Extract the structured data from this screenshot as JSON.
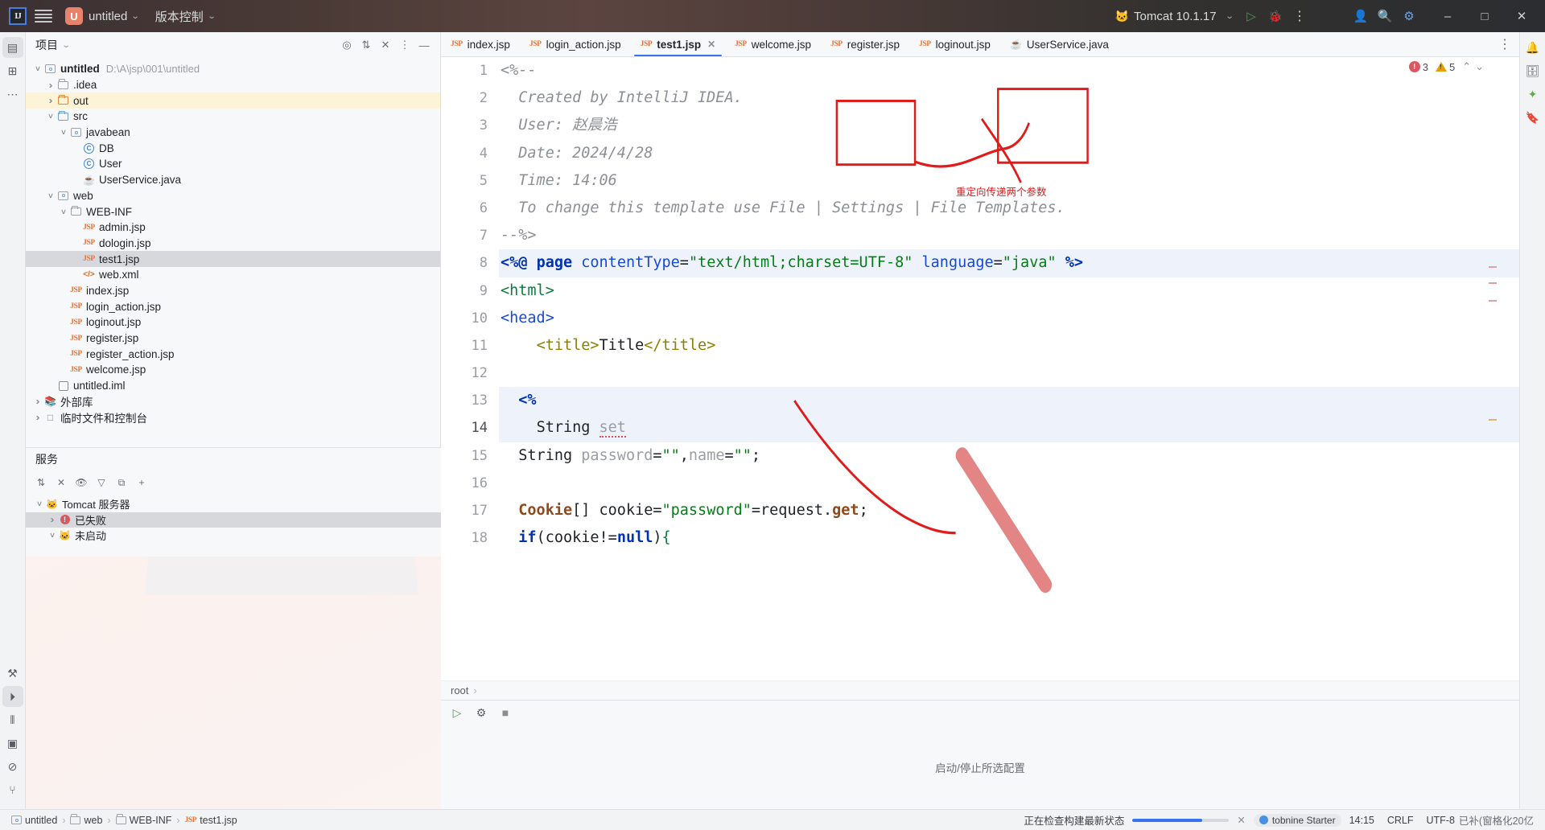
{
  "titlebar": {
    "logo": "ij-logo",
    "menu_icon": "hamburger-menu-icon",
    "project_chip": "U",
    "project_name": "untitled",
    "vcs_label": "版本控制",
    "run_config": "Tomcat 10.1.17",
    "run_icon": "run-icon",
    "debug_icon": "debug-icon",
    "more_icon": "more-vertical-icon",
    "account_icon": "account-icon",
    "search_icon": "search-icon",
    "settings_icon": "settings-gear-icon",
    "minimize": "–",
    "maximize": "□",
    "close": "✕"
  },
  "left_rail": {
    "items": [
      {
        "name": "project-tool-window",
        "glyph": "▤",
        "active": true
      },
      {
        "name": "commit-tool-window",
        "glyph": "⊞",
        "active": false
      },
      {
        "name": "more-tool-windows",
        "glyph": "…",
        "active": false
      }
    ],
    "bottom_items": [
      {
        "name": "build-tool-window",
        "glyph": "⚒",
        "active": false
      },
      {
        "name": "services-tool-window",
        "glyph": "⏵",
        "active": true
      },
      {
        "name": "structure-tool-window",
        "glyph": "⫴",
        "active": false
      },
      {
        "name": "terminal-tool-window",
        "glyph": "▣",
        "active": false
      },
      {
        "name": "problems-tool-window",
        "glyph": "⊘",
        "active": false
      },
      {
        "name": "profiler-tool-window",
        "glyph": "ᛘ",
        "active": false
      }
    ]
  },
  "project_panel": {
    "title": "项目",
    "header_icons": [
      "locate-icon",
      "expand-collapse-icon",
      "collapse-all-icon",
      "options-icon",
      "hide-icon"
    ],
    "tree": [
      {
        "depth": 0,
        "arrow": "open",
        "icon": "module-root",
        "label": "untitled",
        "bold": true,
        "path": "D:\\A\\jsp\\001\\untitled",
        "state": ""
      },
      {
        "depth": 1,
        "arrow": "closed",
        "icon": "folder-grey",
        "label": ".idea",
        "bold": false,
        "path": "",
        "state": ""
      },
      {
        "depth": 1,
        "arrow": "closed",
        "icon": "folder-orange",
        "label": "out",
        "bold": false,
        "path": "",
        "state": "hl"
      },
      {
        "depth": 1,
        "arrow": "open",
        "icon": "folder-blue",
        "label": "src",
        "bold": false,
        "path": "",
        "state": ""
      },
      {
        "depth": 2,
        "arrow": "open",
        "icon": "package",
        "label": "javabean",
        "bold": false,
        "path": "",
        "state": ""
      },
      {
        "depth": 3,
        "arrow": "",
        "icon": "class",
        "label": "DB",
        "bold": false,
        "path": "",
        "state": ""
      },
      {
        "depth": 3,
        "arrow": "",
        "icon": "class",
        "label": "User",
        "bold": false,
        "path": "",
        "state": ""
      },
      {
        "depth": 3,
        "arrow": "",
        "icon": "java",
        "label": "UserService.java",
        "bold": false,
        "path": "",
        "state": ""
      },
      {
        "depth": 1,
        "arrow": "open",
        "icon": "package",
        "label": "web",
        "bold": false,
        "path": "",
        "state": ""
      },
      {
        "depth": 2,
        "arrow": "open",
        "icon": "folder-grey",
        "label": "WEB-INF",
        "bold": false,
        "path": "",
        "state": ""
      },
      {
        "depth": 3,
        "arrow": "",
        "icon": "jsp",
        "label": "admin.jsp",
        "bold": false,
        "path": "",
        "state": ""
      },
      {
        "depth": 3,
        "arrow": "",
        "icon": "jsp",
        "label": "dologin.jsp",
        "bold": false,
        "path": "",
        "state": ""
      },
      {
        "depth": 3,
        "arrow": "",
        "icon": "jsp",
        "label": "test1.jsp",
        "bold": false,
        "path": "",
        "state": "sel"
      },
      {
        "depth": 3,
        "arrow": "",
        "icon": "xml",
        "label": "web.xml",
        "bold": false,
        "path": "",
        "state": ""
      },
      {
        "depth": 2,
        "arrow": "",
        "icon": "jsp",
        "label": "index.jsp",
        "bold": false,
        "path": "",
        "state": ""
      },
      {
        "depth": 2,
        "arrow": "",
        "icon": "jsp",
        "label": "login_action.jsp",
        "bold": false,
        "path": "",
        "state": ""
      },
      {
        "depth": 2,
        "arrow": "",
        "icon": "jsp",
        "label": "loginout.jsp",
        "bold": false,
        "path": "",
        "state": ""
      },
      {
        "depth": 2,
        "arrow": "",
        "icon": "jsp",
        "label": "register.jsp",
        "bold": false,
        "path": "",
        "state": ""
      },
      {
        "depth": 2,
        "arrow": "",
        "icon": "jsp",
        "label": "register_action.jsp",
        "bold": false,
        "path": "",
        "state": ""
      },
      {
        "depth": 2,
        "arrow": "",
        "icon": "jsp",
        "label": "welcome.jsp",
        "bold": false,
        "path": "",
        "state": ""
      },
      {
        "depth": 1,
        "arrow": "",
        "icon": "iml",
        "label": "untitled.iml",
        "bold": false,
        "path": "",
        "state": ""
      },
      {
        "depth": 0,
        "arrow": "closed",
        "icon": "library",
        "label": "外部库",
        "bold": false,
        "path": "",
        "state": ""
      },
      {
        "depth": 0,
        "arrow": "closed",
        "icon": "scratch",
        "label": "临时文件和控制台",
        "bold": false,
        "path": "",
        "state": ""
      }
    ]
  },
  "services": {
    "title": "服务",
    "toolbar_icons": [
      "sort-icon",
      "stop-icon",
      "watch-icon",
      "filter-icon",
      "group-icon",
      "add-icon"
    ],
    "rows": [
      {
        "depth": 0,
        "arrow": "open",
        "icon": "tomcat-icon",
        "label": "Tomcat 服务器",
        "state": ""
      },
      {
        "depth": 1,
        "arrow": "closed",
        "icon": "error-icon",
        "label": "已失败",
        "state": "sel"
      },
      {
        "depth": 1,
        "arrow": "open",
        "icon": "tomcat-icon",
        "label": "未启动",
        "state": ""
      }
    ]
  },
  "editor": {
    "tabs": [
      {
        "label": "index.jsp",
        "icon": "jsp-icon",
        "active": false,
        "closable": false
      },
      {
        "label": "login_action.jsp",
        "icon": "jsp-icon",
        "active": false,
        "closable": false
      },
      {
        "label": "test1.jsp",
        "icon": "jsp-icon",
        "active": true,
        "closable": true
      },
      {
        "label": "welcome.jsp",
        "icon": "jsp-icon",
        "active": false,
        "closable": false
      },
      {
        "label": "register.jsp",
        "icon": "jsp-icon",
        "active": false,
        "closable": false
      },
      {
        "label": "loginout.jsp",
        "icon": "jsp-icon",
        "active": false,
        "closable": false
      },
      {
        "label": "UserService.java",
        "icon": "java-icon",
        "active": false,
        "closable": false
      }
    ],
    "tab_more_icon": "more-vertical-icon",
    "inspection": {
      "error_count": "3",
      "warning_count": "5",
      "expand_icon": "chevron-up-icon",
      "collapse_icon": "chevron-down-icon"
    },
    "breadcrumb": [
      "root"
    ],
    "lines": [
      {
        "n": "1",
        "cur": false,
        "hl": false,
        "tokens": [
          {
            "t": "<%--",
            "c": "cmt"
          }
        ]
      },
      {
        "n": "2",
        "cur": false,
        "hl": false,
        "tokens": [
          {
            "t": "  Created by IntelliJ IDEA.",
            "c": "cmt"
          }
        ]
      },
      {
        "n": "3",
        "cur": false,
        "hl": false,
        "tokens": [
          {
            "t": "  User: 赵晨浩",
            "c": "cmt"
          }
        ]
      },
      {
        "n": "4",
        "cur": false,
        "hl": false,
        "tokens": [
          {
            "t": "  Date: 2024/4/28",
            "c": "cmt"
          }
        ]
      },
      {
        "n": "5",
        "cur": false,
        "hl": false,
        "tokens": [
          {
            "t": "  Time: 14:06",
            "c": "cmt"
          }
        ]
      },
      {
        "n": "6",
        "cur": false,
        "hl": false,
        "tokens": [
          {
            "t": "  To change this template use File | Settings | File Templates.",
            "c": "cmt"
          }
        ]
      },
      {
        "n": "7",
        "cur": false,
        "hl": false,
        "tokens": [
          {
            "t": "--%>",
            "c": "cmt"
          }
        ]
      },
      {
        "n": "8",
        "cur": false,
        "hl": true,
        "tokens": [
          {
            "t": "<%@ ",
            "c": "kw"
          },
          {
            "t": "page ",
            "c": "kw"
          },
          {
            "t": "contentType",
            "c": "attr"
          },
          {
            "t": "=",
            "c": "plain"
          },
          {
            "t": "\"text/html;charset=UTF-8\"",
            "c": "str"
          },
          {
            "t": " ",
            "c": "plain"
          },
          {
            "t": "language",
            "c": "attr"
          },
          {
            "t": "=",
            "c": "plain"
          },
          {
            "t": "\"java\"",
            "c": "str"
          },
          {
            "t": " ",
            "c": "plain"
          },
          {
            "t": "%>",
            "c": "kw"
          }
        ]
      },
      {
        "n": "9",
        "cur": false,
        "hl": false,
        "tokens": [
          {
            "t": "<html>",
            "c": "tag"
          }
        ]
      },
      {
        "n": "10",
        "cur": false,
        "hl": false,
        "tokens": [
          {
            "t": "<head>",
            "c": "attr"
          }
        ]
      },
      {
        "n": "11",
        "cur": false,
        "hl": false,
        "tokens": [
          {
            "t": "    ",
            "c": "plain"
          },
          {
            "t": "<title>",
            "c": "tag2"
          },
          {
            "t": "Title",
            "c": "plain"
          },
          {
            "t": "</title>",
            "c": "tag2"
          }
        ]
      },
      {
        "n": "12",
        "cur": false,
        "hl": false,
        "tokens": [
          {
            "t": "",
            "c": "plain"
          }
        ]
      },
      {
        "n": "13",
        "cur": false,
        "hl": true,
        "tokens": [
          {
            "t": "  ",
            "c": "plain"
          },
          {
            "t": "<%",
            "c": "kw"
          }
        ]
      },
      {
        "n": "14",
        "cur": true,
        "hl": true,
        "tokens": [
          {
            "t": "    ",
            "c": "plain"
          },
          {
            "t": "String ",
            "c": "plain"
          },
          {
            "t": "set",
            "c": "grey err"
          }
        ]
      },
      {
        "n": "15",
        "cur": false,
        "hl": false,
        "tokens": [
          {
            "t": "  String ",
            "c": "plain"
          },
          {
            "t": "password",
            "c": "grey"
          },
          {
            "t": "=",
            "c": "plain"
          },
          {
            "t": "\"\"",
            "c": "str"
          },
          {
            "t": ",",
            "c": "plain"
          },
          {
            "t": "name",
            "c": "grey"
          },
          {
            "t": "=",
            "c": "plain"
          },
          {
            "t": "\"\"",
            "c": "str"
          },
          {
            "t": ";",
            "c": "plain"
          }
        ]
      },
      {
        "n": "16",
        "cur": false,
        "hl": false,
        "tokens": [
          {
            "t": "",
            "c": "plain"
          }
        ]
      },
      {
        "n": "17",
        "cur": false,
        "hl": false,
        "tokens": [
          {
            "t": "  ",
            "c": "plain"
          },
          {
            "t": "Cookie",
            "c": "typ"
          },
          {
            "t": "[] ",
            "c": "plain"
          },
          {
            "t": "cookie",
            "c": "plain"
          },
          {
            "t": "=",
            "c": "plain"
          },
          {
            "t": "\"password\"",
            "c": "str"
          },
          {
            "t": "=",
            "c": "plain"
          },
          {
            "t": "request.",
            "c": "plain"
          },
          {
            "t": "get",
            "c": "typ"
          },
          {
            "t": ";",
            "c": "plain"
          }
        ]
      },
      {
        "n": "18",
        "cur": false,
        "hl": false,
        "tokens": [
          {
            "t": "  ",
            "c": "plain"
          },
          {
            "t": "if",
            "c": "kw"
          },
          {
            "t": "(",
            "c": "plain"
          },
          {
            "t": "cookie",
            "c": "plain"
          },
          {
            "t": "!=",
            "c": "plain"
          },
          {
            "t": "null",
            "c": "kw"
          },
          {
            "t": ")",
            "c": "plain"
          },
          {
            "t": "{",
            "c": "tag"
          }
        ]
      }
    ]
  },
  "run_panel": {
    "run_icon": "run-icon",
    "settings_icon": "settings-gear-icon",
    "stop_icon": "stop-icon",
    "message": "启动/停止所选配置"
  },
  "right_rail": {
    "items": [
      {
        "name": "notifications-tool-window",
        "glyph": "🔔"
      },
      {
        "name": "database-tool-window",
        "glyph": "🗄"
      },
      {
        "name": "ai-assistant-tool-window",
        "glyph": "✦"
      },
      {
        "name": "bookmarks-tool-window",
        "glyph": "🔖"
      }
    ]
  },
  "statusbar": {
    "breadcrumb": [
      "untitled",
      "web",
      "WEB-INF",
      "test1.jsp"
    ],
    "breadcrumb_icons": [
      "module-icon",
      "folder-icon",
      "folder-icon",
      "jsp-icon"
    ],
    "build_status": "正在检查构建最新状态",
    "cancel_icon": "close-icon",
    "plugin_badge": "tobnine Starter",
    "caret_position": "14:15",
    "line_separator": "CRLF",
    "encoding": "UTF-8",
    "encoding_extra": "已补(窗格化20亿",
    "progress_percent": 72
  },
  "annotations": {
    "redirect_note": "重定向传递两个参数",
    "accent_red": "#d02020"
  }
}
